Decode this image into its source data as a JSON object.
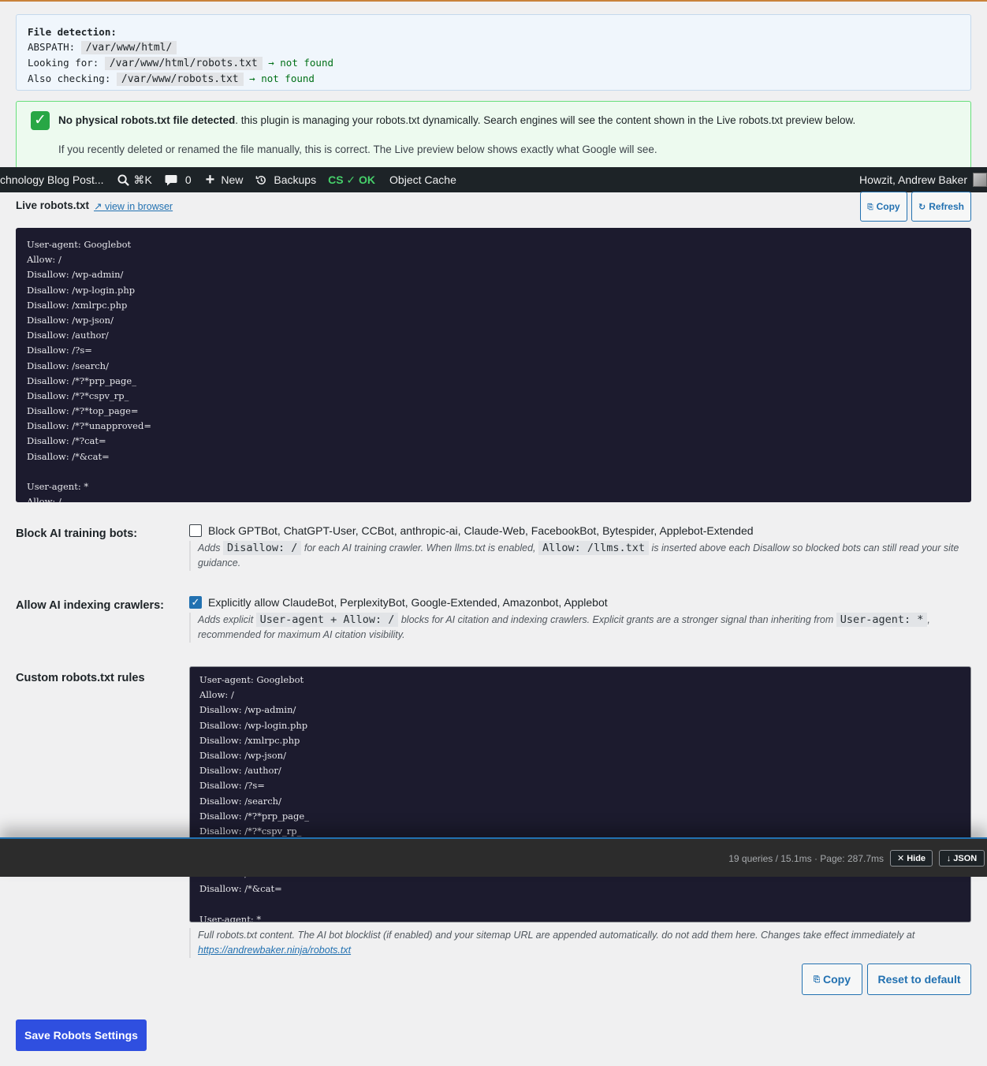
{
  "detection": {
    "heading": "File detection:",
    "abspath_label": "ABSPATH:",
    "abspath_value": "/var/www/html/",
    "looking_label": "Looking for:",
    "looking_value": "/var/www/html/robots.txt",
    "looking_status": "→ not found",
    "also_label": "Also checking:",
    "also_value": "/var/www/robots.txt",
    "also_status": "→ not found"
  },
  "notice": {
    "bold": "No physical robots.txt file detected",
    "rest": ". this plugin is managing your robots.txt dynamically. Search engines will see the content shown in the Live robots.txt preview below.",
    "line2": "If you recently deleted or renamed the file manually, this is correct. The Live preview below shows exactly what Google will see."
  },
  "adminbar": {
    "site": "chnology Blog Post...",
    "search_shortcut": "⌘K",
    "comments_count": "0",
    "new_label": "New",
    "backups_label": "Backups",
    "cs_status": "CS ✓ OK",
    "object_cache": "Object Cache",
    "greeting": "Howzit, Andrew Baker"
  },
  "live": {
    "label": "Live robots.txt",
    "link": "↗ view in browser",
    "copy_label": "Copy",
    "refresh_label": "Refresh",
    "lines": [
      "User-agent: Googlebot",
      "Allow: /",
      "Disallow: /wp-admin/",
      "Disallow: /wp-login.php",
      "Disallow: /xmlrpc.php",
      "Disallow: /wp-json/",
      "Disallow: /author/",
      "Disallow: /?s=",
      "Disallow: /search/",
      "Disallow: /*?*prp_page_",
      "Disallow: /*?*cspv_rp_",
      "Disallow: /*?*top_page=",
      "Disallow: /*?*unapproved=",
      "Disallow: /*?cat=",
      "Disallow: /*&cat=",
      "",
      "User-agent: *",
      "Allow: /"
    ]
  },
  "block_ai": {
    "label": "Block AI training bots:",
    "checked": false,
    "checkbox_text": "Block GPTBot, ChatGPT-User, CCBot, anthropic-ai, Claude-Web, FacebookBot, Bytespider, Applebot-Extended",
    "desc_a": "Adds",
    "code_1": "Disallow: /",
    "desc_b": "for each AI training crawler. When llms.txt is enabled,",
    "code_2": "Allow: /llms.txt",
    "desc_c": "is inserted above each Disallow so blocked bots can still read your site guidance."
  },
  "allow_ai": {
    "label": "Allow AI indexing crawlers:",
    "checked": true,
    "checkbox_text": "Explicitly allow ClaudeBot, PerplexityBot, Google-Extended, Amazonbot, Applebot",
    "desc_a": "Adds explicit",
    "code_1": "User-agent + Allow: /",
    "desc_b": "blocks for AI citation and indexing crawlers. Explicit grants are a stronger signal than inheriting from",
    "code_2": "User-agent: *",
    "desc_c": ", recommended for maximum AI citation visibility."
  },
  "custom": {
    "label": "Custom robots.txt rules",
    "lines": [
      "User-agent: Googlebot",
      "Allow: /",
      "Disallow: /wp-admin/",
      "Disallow: /wp-login.php",
      "Disallow: /xmlrpc.php",
      "Disallow: /wp-json/",
      "Disallow: /author/",
      "Disallow: /?s=",
      "Disallow: /search/",
      "Disallow: /*?*prp_page_",
      "Disallow: /*?*cspv_rp_"
    ],
    "lines_after": [
      "Disallow: /*?cat=",
      "Disallow: /*&cat=",
      "",
      "User-agent: *"
    ],
    "help": "Full robots.txt content. The AI bot blocklist (if enabled) and your sitemap URL are appended automatically. do not add them here. Changes take effect immediately at",
    "help_link": "https://andrewbaker.ninja/robots.txt",
    "copy_label": "Copy",
    "reset_label": "Reset to default"
  },
  "query_monitor": {
    "stats": "19 queries / 15.1ms · Page: 287.7ms",
    "hide_label": "✕ Hide",
    "json_label": "↓ JSON"
  },
  "save_label": "Save Robots Settings"
}
